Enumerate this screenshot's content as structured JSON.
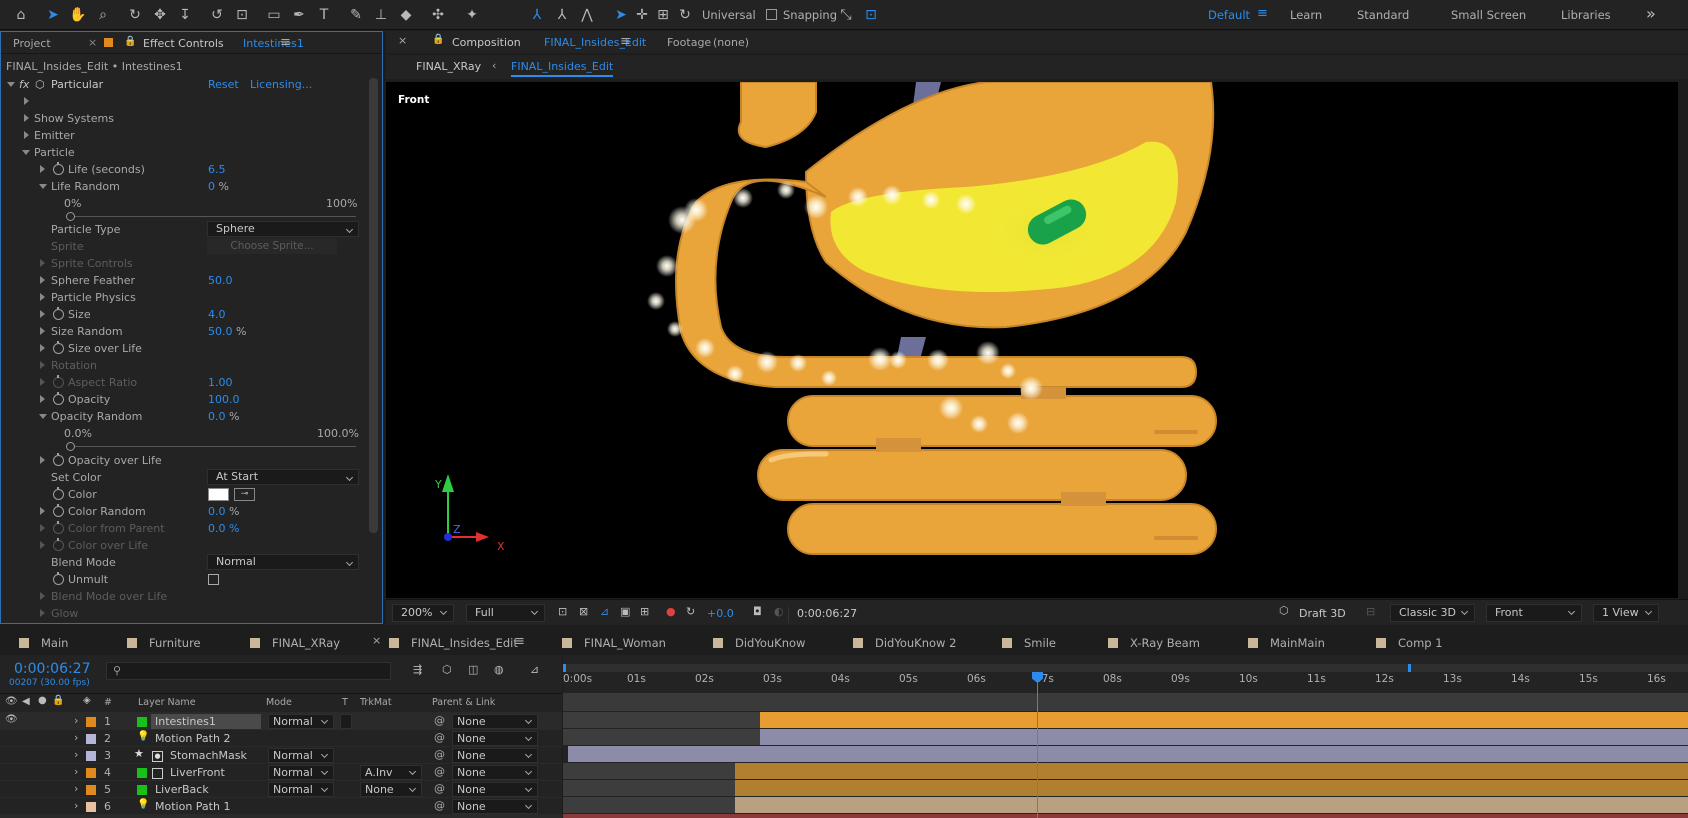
{
  "toolbar": {
    "mode": "Universal",
    "snapping": "Snapping",
    "workspaces": [
      "Default",
      "Learn",
      "Standard",
      "Small Screen",
      "Libraries"
    ],
    "more": "»"
  },
  "effect_panel": {
    "tab_project": "Project",
    "tab_effect": "Effect Controls",
    "tab_layer": "Intestines1",
    "breadcrumb": "FINAL_Insides_Edit • Intestines1",
    "effect_name": "Particular",
    "reset": "Reset",
    "licensing": "Licensing...",
    "rows": {
      "show_systems": "Show Systems",
      "emitter": "Emitter",
      "particle": "Particle",
      "life": "Life (seconds)",
      "life_val": "6.5",
      "life_random": "Life Random",
      "life_random_val": "0",
      "slider1_min": "0%",
      "slider1_max": "100%",
      "particle_type": "Particle Type",
      "particle_type_val": "Sphere",
      "sprite": "Sprite",
      "sprite_btn": "Choose Sprite...",
      "sprite_controls": "Sprite Controls",
      "sphere_feather": "Sphere Feather",
      "sphere_feather_val": "50.0",
      "particle_physics": "Particle Physics",
      "size": "Size",
      "size_val": "4.0",
      "size_random": "Size Random",
      "size_random_val": "50.0",
      "size_over_life": "Size over Life",
      "rotation": "Rotation",
      "aspect_ratio": "Aspect Ratio",
      "aspect_ratio_val": "1.00",
      "opacity": "Opacity",
      "opacity_val": "100.0",
      "opacity_random": "Opacity Random",
      "opacity_random_val": "0.0",
      "slider2_min": "0.0%",
      "slider2_max": "100.0%",
      "opacity_over_life": "Opacity over Life",
      "set_color": "Set Color",
      "set_color_val": "At Start",
      "color": "Color",
      "color_random": "Color Random",
      "color_random_val": "0.0",
      "color_from_parent": "Color from Parent",
      "color_from_parent_val": "0.0",
      "color_over_life": "Color over Life",
      "blend_mode": "Blend Mode",
      "blend_mode_val": "Normal",
      "unmult": "Unmult",
      "blend_mode_over_life": "Blend Mode over Life",
      "glow": "Glow",
      "percent": "%"
    }
  },
  "composition": {
    "tab_label": "Composition",
    "comp_name": "FINAL_Insides_Edit",
    "footage": "Footage",
    "footage_val": "(none)",
    "crumb_parent": "FINAL_XRay",
    "crumb_current": "FINAL_Insides_Edit",
    "view_label": "Front",
    "axes": {
      "x": "X",
      "y": "Y",
      "z": "Z"
    }
  },
  "viewer_bar": {
    "zoom": "200%",
    "resolution": "Full",
    "exposure": "+0.0",
    "timecode": "0:00:06:27",
    "draft": "Draft 3D",
    "renderer": "Classic 3D",
    "view": "Front",
    "views": "1 View"
  },
  "timeline": {
    "tabs": [
      "Main",
      "Furniture",
      "FINAL_XRay",
      "FINAL_Insides_Edit",
      "FINAL_Woman",
      "DidYouKnow",
      "DidYouKnow 2",
      "Smile",
      "X-Ray Beam",
      "MainMain",
      "Comp 1"
    ],
    "timecode": "0:00:06:27",
    "frames": "00207 (30.00 fps)",
    "headers": {
      "hash": "#",
      "layer_name": "Layer Name",
      "mode": "Mode",
      "t": "T",
      "trkmat": "TrkMat",
      "parent": "Parent & Link"
    },
    "ruler": [
      "0:00s",
      "01s",
      "02s",
      "03s",
      "04s",
      "05s",
      "06s",
      "07s",
      "08s",
      "09s",
      "10s",
      "11s",
      "12s",
      "13s",
      "14s",
      "15s",
      "16s"
    ],
    "layers": [
      {
        "num": "1",
        "name": "Intestines1",
        "mode": "Normal",
        "trkmat": "",
        "parent": "None",
        "color": "#18c018"
      },
      {
        "num": "2",
        "name": "Motion Path 2",
        "mode": "",
        "trkmat": "",
        "parent": "None",
        "color": "#c0c0e0"
      },
      {
        "num": "3",
        "name": "StomachMask",
        "mode": "Normal",
        "trkmat": "",
        "parent": "None",
        "color": "#c0c0e0"
      },
      {
        "num": "4",
        "name": "LiverFront",
        "mode": "Normal",
        "trkmat": "A.Inv",
        "parent": "None",
        "color": "#18c018"
      },
      {
        "num": "5",
        "name": "LiverBack",
        "mode": "Normal",
        "trkmat": "None",
        "parent": "None",
        "color": "#18c018"
      },
      {
        "num": "6",
        "name": "Motion Path 1",
        "mode": "",
        "trkmat": "",
        "parent": "None",
        "color": "#e8c0a0"
      }
    ]
  },
  "colors": {
    "accent": "#2d8ceb",
    "panel": "#232323",
    "orange": "#e9a53a",
    "yellow": "#f2e834"
  }
}
